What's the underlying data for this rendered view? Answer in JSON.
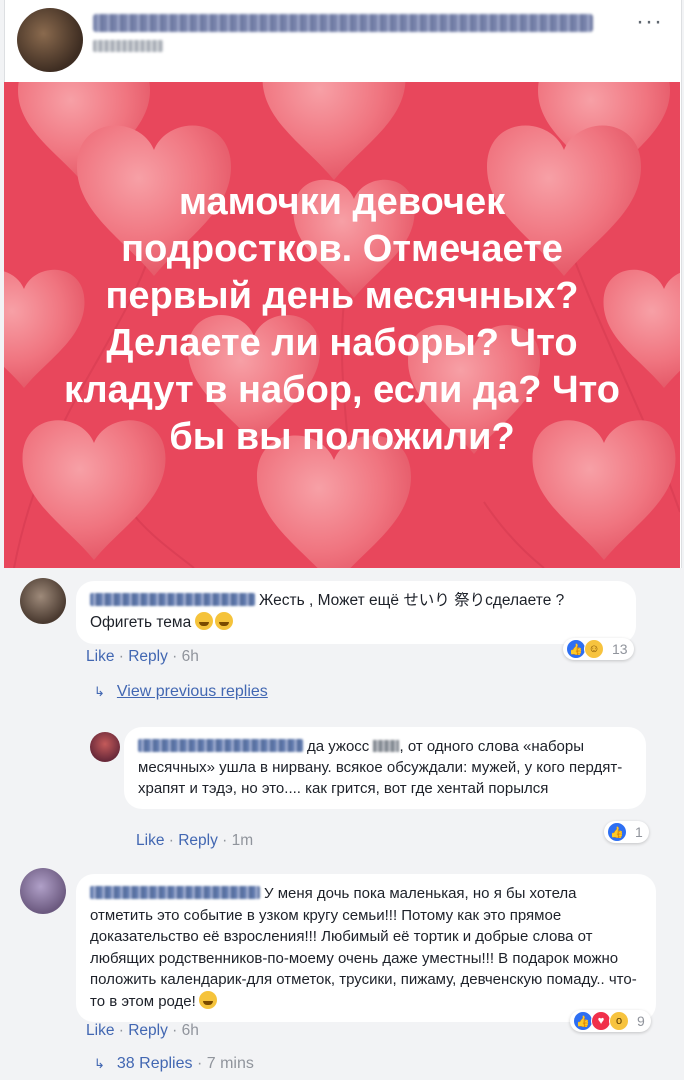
{
  "post": {
    "options_label": "···",
    "banner_text": "мамочки девочек подростков. Отмечаете первый день месячных? Делаете ли наборы? Что кладут в набор, если да? Что бы вы положили?",
    "banner_color": "#e8475c"
  },
  "comments": [
    {
      "text": "Жесть , Может ещё せいり 祭りсделаете ? Офигеть тема",
      "like_label": "Like",
      "reply_label": "Reply",
      "time": "6h",
      "reaction_count": "13",
      "reactions": [
        "like-icon",
        "haha-icon"
      ]
    },
    {
      "text_before": "да ужосс",
      "text_after": ", от одного слова «наборы месячных» ушла в нирвану. всякое обсуждали: мужей, у кого пердят-храпят и тэдэ, но это.... как грится, вот где хентай порылся",
      "like_label": "Like",
      "reply_label": "Reply",
      "time": "1m",
      "reaction_count": "1",
      "reactions": [
        "like-icon"
      ]
    },
    {
      "text": "У меня дочь пока маленькая, но я бы хотела отметить это событие в узком кругу семьи!!! Потому как это прямое доказательство её взросления!!! Любимый её тортик и добрые слова от любящих родственников-по-моему очень даже уместны!!! В подарок можно положить календарик-для отметок, трусики, пижаму, девченскую помаду.. что-то в этом роде!",
      "like_label": "Like",
      "reply_label": "Reply",
      "time": "6h",
      "reaction_count": "9",
      "reactions": [
        "like-icon",
        "love-icon",
        "wow-icon"
      ]
    }
  ],
  "view_previous_replies": "View previous replies",
  "replies_link": {
    "label": "38 Replies",
    "time": "7 mins"
  },
  "colors": {
    "link": "#4267b2",
    "meta": "#90949c",
    "bubble": "#ffffff",
    "page_bg": "#f2f3f5"
  }
}
